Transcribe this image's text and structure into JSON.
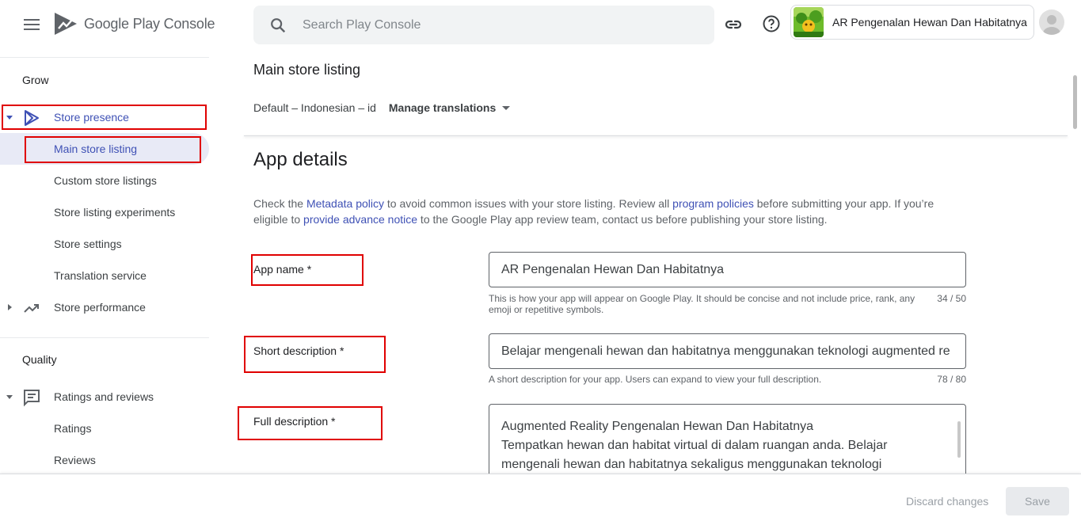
{
  "header": {
    "product_name": "Google Play Console",
    "search_placeholder": "Search Play Console",
    "app_name": "AR Pengenalan Hewan Dan Habitatnya"
  },
  "sidebar": {
    "grow_heading": "Grow",
    "store_presence": "Store presence",
    "main_store_listing": "Main store listing",
    "custom_store_listings": "Custom store listings",
    "store_listing_experiments": "Store listing experiments",
    "store_settings": "Store settings",
    "translation_service": "Translation service",
    "store_performance": "Store performance",
    "quality_heading": "Quality",
    "ratings_and_reviews": "Ratings and reviews",
    "ratings": "Ratings",
    "reviews": "Reviews"
  },
  "main": {
    "page_title": "Main store listing",
    "language": "Default – Indonesian – id",
    "manage_translations": "Manage translations",
    "section_title": "App details",
    "intro": {
      "p1": "Check the ",
      "link1": "Metadata policy",
      "p2": " to avoid common issues with your store listing. Review all ",
      "link2": "program policies",
      "p3": " before submitting your app. If you’re eligible to ",
      "link3": "provide advance notice",
      "p4": " to the Google Play app review team, contact us before publishing your store listing."
    },
    "app_name": {
      "label": "App name  *",
      "value": "AR Pengenalan Hewan Dan Habitatnya",
      "help": "This is how your app will appear on Google Play. It should be concise and not include price, rank, any emoji or repetitive symbols.",
      "count": "34 / 50"
    },
    "short_description": {
      "label": "Short description  *",
      "value": "Belajar mengenali hewan dan habitatnya menggunakan teknologi augmented re",
      "help": "A short description for your app. Users can expand to view your full description.",
      "count": "78 / 80"
    },
    "full_description": {
      "label": "Full description  *",
      "line1": "Augmented Reality Pengenalan Hewan Dan Habitatnya",
      "line2": "Tempatkan hewan dan habitat virtual di dalam ruangan anda. Belajar",
      "line3": "mengenali hewan dan habitatnya sekaligus menggunakan teknologi"
    }
  },
  "footer": {
    "discard_label": "Discard changes",
    "save_label": "Save"
  },
  "colors": {
    "accent": "#3f51b5",
    "annotation_red": "#e00000",
    "active_bg": "#e8eaf6"
  }
}
